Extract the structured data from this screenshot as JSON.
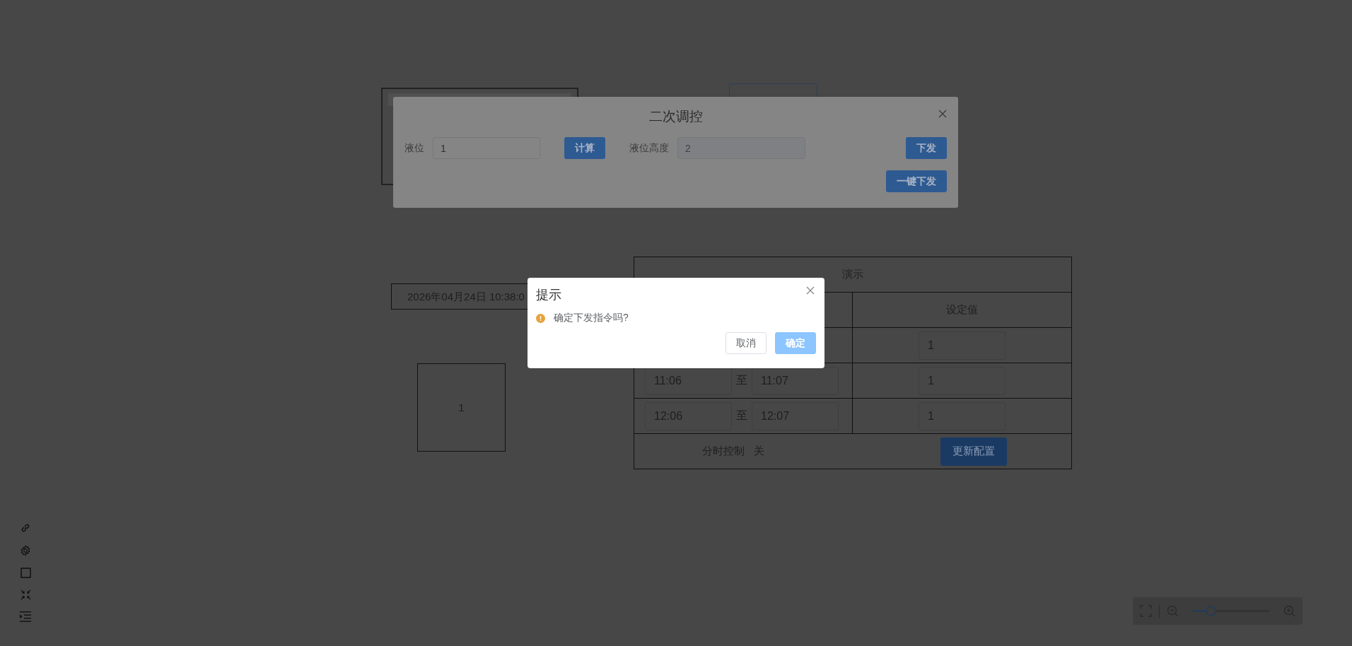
{
  "page": {
    "clock": "2026年04月24日 10:38:0",
    "value_tile": "1",
    "table": {
      "title": "演示",
      "column": "设定值",
      "rows": [
        {
          "setpoint": "1"
        },
        {
          "start": "11:06",
          "separator": "至",
          "end": "11:07",
          "setpoint": "1"
        },
        {
          "start": "12:06",
          "separator": "至",
          "end": "12:07",
          "setpoint": "1"
        }
      ],
      "footer": {
        "label": "分时控制",
        "state": "关",
        "button": "更新配置"
      }
    }
  },
  "zoom_control": {
    "level": 0.2
  },
  "dialog": {
    "title": "二次调控",
    "fields": [
      {
        "label": "液位",
        "value": "1",
        "disabled": false,
        "button": "计算"
      },
      {
        "label": "液位高度",
        "value": "2",
        "disabled": true,
        "button": "下发"
      }
    ],
    "bulk_button": "一键下发"
  },
  "confirm": {
    "title": "提示",
    "message": "确定下发指令吗?",
    "buttons": [
      {
        "label": "取消",
        "kind": "default",
        "disabled": false
      },
      {
        "label": "确定",
        "kind": "primary",
        "disabled": true
      }
    ]
  }
}
